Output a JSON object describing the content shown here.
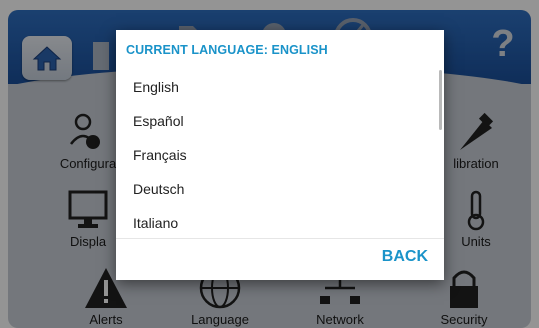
{
  "toolbar": {
    "home_icon": "home-icon",
    "help_label": "?"
  },
  "menu": {
    "configuration_label": "Configura",
    "calibration_label": "libration",
    "display_label": "Displa",
    "units_label": "Units",
    "alerts_label": "Alerts",
    "language_label": "Language",
    "network_label": "Network",
    "security_label": "Security"
  },
  "dialog": {
    "title": "CURRENT LANGUAGE: ENGLISH",
    "languages": [
      "English",
      "Español",
      "Français",
      "Deutsch",
      "Italiano"
    ],
    "back_label": "BACK"
  },
  "colors": {
    "accent": "#1a93c9",
    "topbar": "#1b4f9a",
    "background": "#c8ced6"
  }
}
